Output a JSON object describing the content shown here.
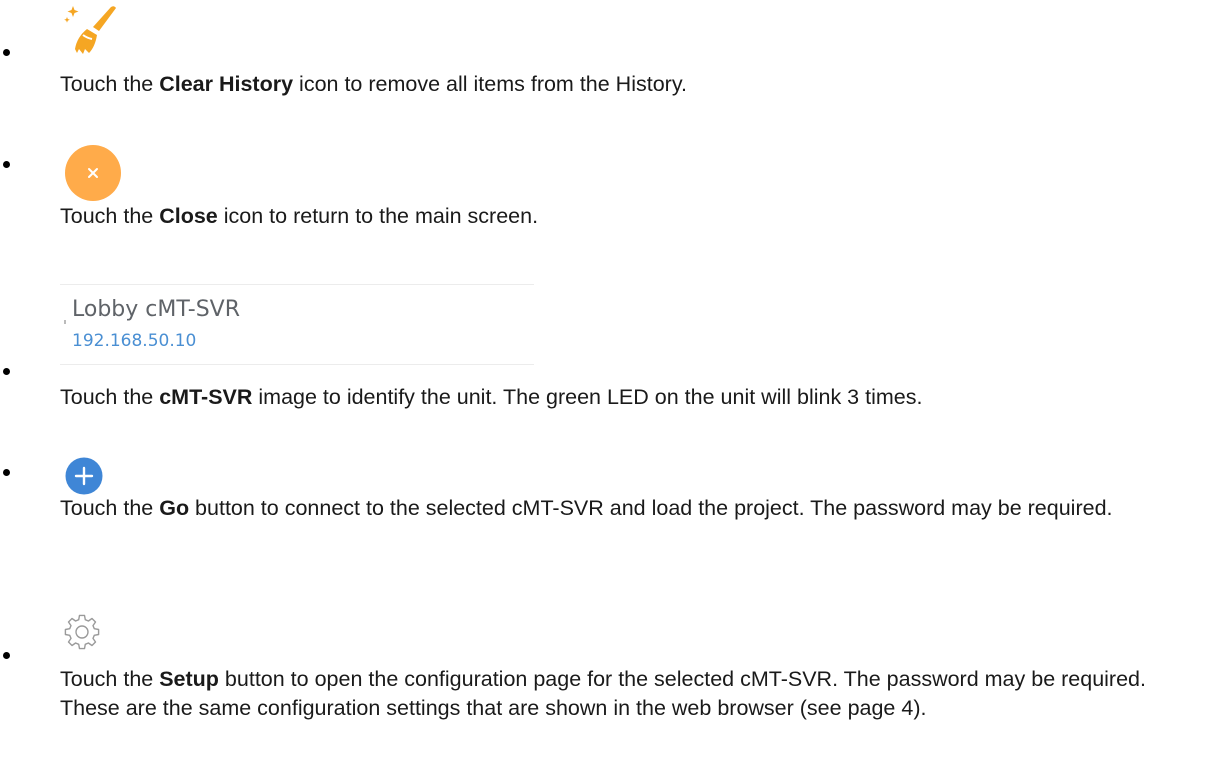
{
  "items": [
    {
      "icon": "clear-history-broom-icon",
      "before": "Touch the ",
      "bold": "Clear History",
      "after": " icon to remove all items from the History."
    },
    {
      "icon": "close-x-icon",
      "before": "Touch the ",
      "bold": "Close",
      "after": " icon to return to the main screen."
    },
    {
      "card": {
        "name": "Lobby cMT-SVR",
        "ip": "192.168.50.10"
      },
      "before": "Touch the ",
      "bold": "cMT-SVR",
      "after": " image to identify the unit. The green LED on the unit will blink 3 times."
    },
    {
      "icon": "go-plus-icon",
      "before": "Touch the ",
      "bold": "Go",
      "after": " button to connect to the selected cMT-SVR and load the project. The password may be required."
    },
    {
      "icon": "setup-gear-icon",
      "before": "Touch the ",
      "bold": "Setup",
      "after": " button to open the configuration page for the selected cMT-SVR. The password may be required. These are the same configuration settings that are shown in the web browser (see page 4)."
    }
  ],
  "colors": {
    "broom": "#f5a623",
    "close_circle": "#ffab4a",
    "go_circle": "#3f86d6",
    "gear": "#9a9a9a",
    "ip_text": "#4a8fd3",
    "card_name": "#5f6368"
  }
}
